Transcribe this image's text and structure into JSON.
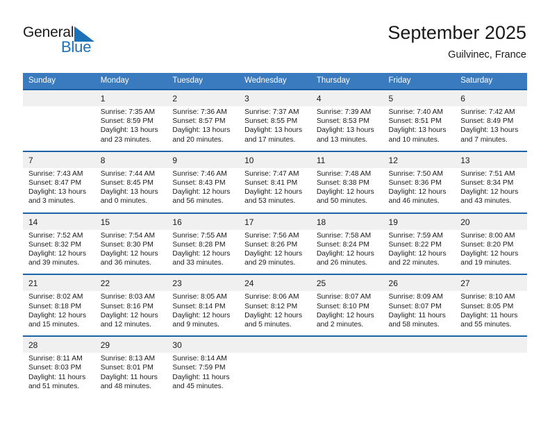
{
  "logo": {
    "word_top": "General",
    "word_bottom": "Blue",
    "triangle_color": "#1b72b8",
    "text_color": "#1a1a1a"
  },
  "header": {
    "title": "September 2025",
    "location": "Guilvinec, France"
  },
  "theme": {
    "header_blue": "#3a7bbf",
    "separator_blue": "#1b62a8",
    "daynum_band": "#f0f0f0",
    "text": "#1a1a1a"
  },
  "weekdays": [
    "Sunday",
    "Monday",
    "Tuesday",
    "Wednesday",
    "Thursday",
    "Friday",
    "Saturday"
  ],
  "weeks": [
    [
      {
        "day": "",
        "lines": []
      },
      {
        "day": "1",
        "lines": [
          "Sunrise: 7:35 AM",
          "Sunset: 8:59 PM",
          "Daylight: 13 hours",
          "and 23 minutes."
        ]
      },
      {
        "day": "2",
        "lines": [
          "Sunrise: 7:36 AM",
          "Sunset: 8:57 PM",
          "Daylight: 13 hours",
          "and 20 minutes."
        ]
      },
      {
        "day": "3",
        "lines": [
          "Sunrise: 7:37 AM",
          "Sunset: 8:55 PM",
          "Daylight: 13 hours",
          "and 17 minutes."
        ]
      },
      {
        "day": "4",
        "lines": [
          "Sunrise: 7:39 AM",
          "Sunset: 8:53 PM",
          "Daylight: 13 hours",
          "and 13 minutes."
        ]
      },
      {
        "day": "5",
        "lines": [
          "Sunrise: 7:40 AM",
          "Sunset: 8:51 PM",
          "Daylight: 13 hours",
          "and 10 minutes."
        ]
      },
      {
        "day": "6",
        "lines": [
          "Sunrise: 7:42 AM",
          "Sunset: 8:49 PM",
          "Daylight: 13 hours",
          "and 7 minutes."
        ]
      }
    ],
    [
      {
        "day": "7",
        "lines": [
          "Sunrise: 7:43 AM",
          "Sunset: 8:47 PM",
          "Daylight: 13 hours",
          "and 3 minutes."
        ]
      },
      {
        "day": "8",
        "lines": [
          "Sunrise: 7:44 AM",
          "Sunset: 8:45 PM",
          "Daylight: 13 hours",
          "and 0 minutes."
        ]
      },
      {
        "day": "9",
        "lines": [
          "Sunrise: 7:46 AM",
          "Sunset: 8:43 PM",
          "Daylight: 12 hours",
          "and 56 minutes."
        ]
      },
      {
        "day": "10",
        "lines": [
          "Sunrise: 7:47 AM",
          "Sunset: 8:41 PM",
          "Daylight: 12 hours",
          "and 53 minutes."
        ]
      },
      {
        "day": "11",
        "lines": [
          "Sunrise: 7:48 AM",
          "Sunset: 8:38 PM",
          "Daylight: 12 hours",
          "and 50 minutes."
        ]
      },
      {
        "day": "12",
        "lines": [
          "Sunrise: 7:50 AM",
          "Sunset: 8:36 PM",
          "Daylight: 12 hours",
          "and 46 minutes."
        ]
      },
      {
        "day": "13",
        "lines": [
          "Sunrise: 7:51 AM",
          "Sunset: 8:34 PM",
          "Daylight: 12 hours",
          "and 43 minutes."
        ]
      }
    ],
    [
      {
        "day": "14",
        "lines": [
          "Sunrise: 7:52 AM",
          "Sunset: 8:32 PM",
          "Daylight: 12 hours",
          "and 39 minutes."
        ]
      },
      {
        "day": "15",
        "lines": [
          "Sunrise: 7:54 AM",
          "Sunset: 8:30 PM",
          "Daylight: 12 hours",
          "and 36 minutes."
        ]
      },
      {
        "day": "16",
        "lines": [
          "Sunrise: 7:55 AM",
          "Sunset: 8:28 PM",
          "Daylight: 12 hours",
          "and 33 minutes."
        ]
      },
      {
        "day": "17",
        "lines": [
          "Sunrise: 7:56 AM",
          "Sunset: 8:26 PM",
          "Daylight: 12 hours",
          "and 29 minutes."
        ]
      },
      {
        "day": "18",
        "lines": [
          "Sunrise: 7:58 AM",
          "Sunset: 8:24 PM",
          "Daylight: 12 hours",
          "and 26 minutes."
        ]
      },
      {
        "day": "19",
        "lines": [
          "Sunrise: 7:59 AM",
          "Sunset: 8:22 PM",
          "Daylight: 12 hours",
          "and 22 minutes."
        ]
      },
      {
        "day": "20",
        "lines": [
          "Sunrise: 8:00 AM",
          "Sunset: 8:20 PM",
          "Daylight: 12 hours",
          "and 19 minutes."
        ]
      }
    ],
    [
      {
        "day": "21",
        "lines": [
          "Sunrise: 8:02 AM",
          "Sunset: 8:18 PM",
          "Daylight: 12 hours",
          "and 15 minutes."
        ]
      },
      {
        "day": "22",
        "lines": [
          "Sunrise: 8:03 AM",
          "Sunset: 8:16 PM",
          "Daylight: 12 hours",
          "and 12 minutes."
        ]
      },
      {
        "day": "23",
        "lines": [
          "Sunrise: 8:05 AM",
          "Sunset: 8:14 PM",
          "Daylight: 12 hours",
          "and 9 minutes."
        ]
      },
      {
        "day": "24",
        "lines": [
          "Sunrise: 8:06 AM",
          "Sunset: 8:12 PM",
          "Daylight: 12 hours",
          "and 5 minutes."
        ]
      },
      {
        "day": "25",
        "lines": [
          "Sunrise: 8:07 AM",
          "Sunset: 8:10 PM",
          "Daylight: 12 hours",
          "and 2 minutes."
        ]
      },
      {
        "day": "26",
        "lines": [
          "Sunrise: 8:09 AM",
          "Sunset: 8:07 PM",
          "Daylight: 11 hours",
          "and 58 minutes."
        ]
      },
      {
        "day": "27",
        "lines": [
          "Sunrise: 8:10 AM",
          "Sunset: 8:05 PM",
          "Daylight: 11 hours",
          "and 55 minutes."
        ]
      }
    ],
    [
      {
        "day": "28",
        "lines": [
          "Sunrise: 8:11 AM",
          "Sunset: 8:03 PM",
          "Daylight: 11 hours",
          "and 51 minutes."
        ]
      },
      {
        "day": "29",
        "lines": [
          "Sunrise: 8:13 AM",
          "Sunset: 8:01 PM",
          "Daylight: 11 hours",
          "and 48 minutes."
        ]
      },
      {
        "day": "30",
        "lines": [
          "Sunrise: 8:14 AM",
          "Sunset: 7:59 PM",
          "Daylight: 11 hours",
          "and 45 minutes."
        ]
      },
      {
        "day": "",
        "lines": []
      },
      {
        "day": "",
        "lines": []
      },
      {
        "day": "",
        "lines": []
      },
      {
        "day": "",
        "lines": []
      }
    ]
  ]
}
